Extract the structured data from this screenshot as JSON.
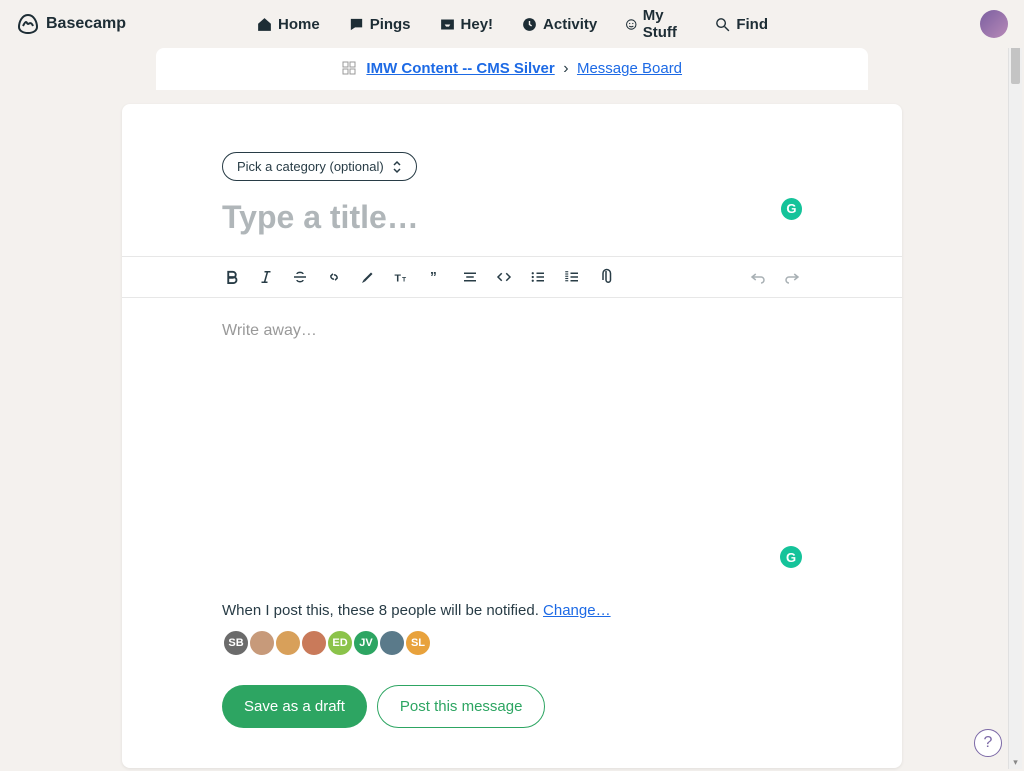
{
  "brand": "Basecamp",
  "nav": {
    "home": "Home",
    "pings": "Pings",
    "hey": "Hey!",
    "activity": "Activity",
    "mystuff": "My Stuff",
    "find": "Find"
  },
  "breadcrumb": {
    "project": "IMW Content -- CMS Silver",
    "section": "Message Board",
    "separator": "›"
  },
  "category_button": "Pick a category (optional)",
  "title_placeholder": "Type a title…",
  "body_placeholder": "Write away…",
  "notify": {
    "text_prefix": "When I post this, these ",
    "count": "8",
    "text_suffix": " people will be notified. ",
    "change": "Change…"
  },
  "avatars": [
    {
      "label": "SB",
      "bg": "#6b6b6b"
    },
    {
      "label": "",
      "bg": "#c79a7a"
    },
    {
      "label": "",
      "bg": "#d8a05a"
    },
    {
      "label": "",
      "bg": "#c97a5a"
    },
    {
      "label": "ED",
      "bg": "#8bc34a"
    },
    {
      "label": "JV",
      "bg": "#2da562"
    },
    {
      "label": "",
      "bg": "#5a7a8a"
    },
    {
      "label": "SL",
      "bg": "#e8a23c"
    }
  ],
  "actions": {
    "draft": "Save as a draft",
    "post": "Post this message"
  },
  "help": "?"
}
